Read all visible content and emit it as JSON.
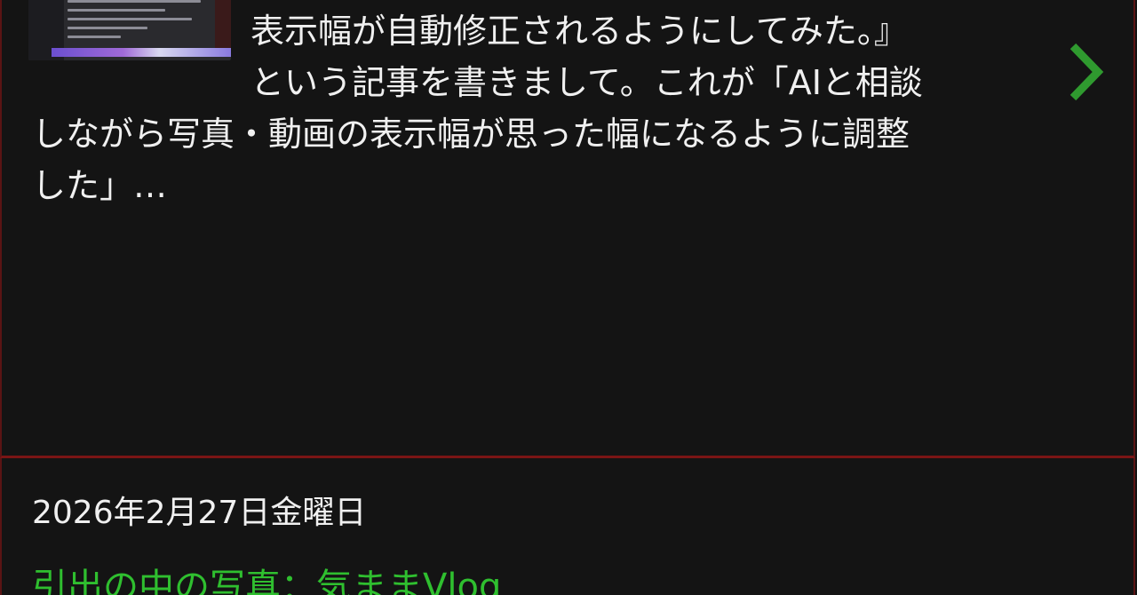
{
  "top_post": {
    "excerpt_lines": [
      "表示幅が自動修正されるようにしてみた。』",
      "という記事を書きまして。これが「AIと相談",
      "しながら写真・動画の表示幅が思った幅になるように調整",
      "した」…"
    ],
    "next_icon": "chevron-right-icon"
  },
  "bottom_post": {
    "date": "2026年2月27日金曜日",
    "title": "引出の中の写真：気ままVlog"
  },
  "colors": {
    "background": "#121212",
    "card_border": "#7a1515",
    "accent_green": "#2fbf2f",
    "text": "#f0f0f0"
  }
}
